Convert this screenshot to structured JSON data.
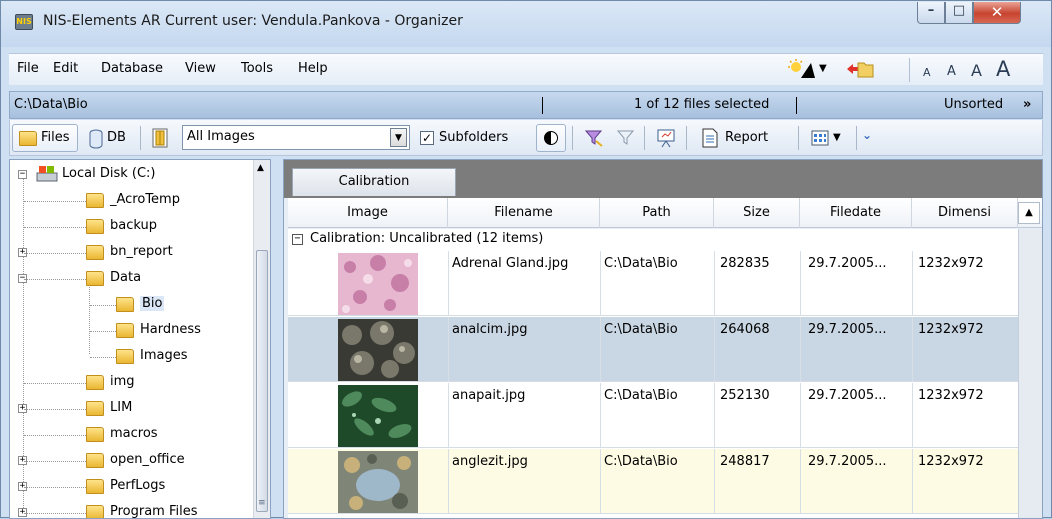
{
  "window": {
    "app_badge": "NIS",
    "title": "NIS-Elements AR  Current user: Vendula.Pankova - Organizer",
    "controls": {
      "minimize": "–",
      "maximize": "□",
      "close": "✕"
    }
  },
  "menubar": {
    "items": [
      "File",
      "Edit",
      "Database",
      "View",
      "Tools",
      "Help"
    ],
    "font_sizes": [
      "A",
      "A",
      "A",
      "A"
    ]
  },
  "pathbar": {
    "path": "C:\\Data\\Bio",
    "selection": "1 of 12 files selected",
    "sort": "Unsorted",
    "more": "»"
  },
  "toolbar": {
    "files_label": "Files",
    "db_label": "DB",
    "filter_value": "All Images",
    "subfolders_label": "Subfolders",
    "subfolders_checked": "✓",
    "report_label": "Report"
  },
  "tree": {
    "items": [
      {
        "label": "Local Disk (C:)",
        "expander": "−"
      },
      {
        "label": "_AcroTemp",
        "expander": ""
      },
      {
        "label": "backup",
        "expander": ""
      },
      {
        "label": "bn_report",
        "expander": "+"
      },
      {
        "label": "Data",
        "expander": "−"
      },
      {
        "label": "Bio",
        "expander": ""
      },
      {
        "label": "Hardness",
        "expander": ""
      },
      {
        "label": "Images",
        "expander": ""
      },
      {
        "label": "img",
        "expander": ""
      },
      {
        "label": "LIM",
        "expander": "+"
      },
      {
        "label": "macros",
        "expander": ""
      },
      {
        "label": "open_office",
        "expander": "+"
      },
      {
        "label": "PerfLogs",
        "expander": "+"
      },
      {
        "label": "Program Files",
        "expander": "+"
      }
    ]
  },
  "grid": {
    "group_button": "Calibration",
    "columns": [
      "Image",
      "Filename",
      "Path",
      "Size",
      "Filedate",
      "Dimensi"
    ],
    "group_label": "Calibration: Uncalibrated (12 items)",
    "group_toggle": "−",
    "rows": [
      {
        "filename": "Adrenal Gland.jpg",
        "path": "C:\\Data\\Bio",
        "size": "282835",
        "filedate": "29.7.2005...",
        "dimension": "1232x972",
        "bg": "#ffffff"
      },
      {
        "filename": "analcim.jpg",
        "path": "C:\\Data\\Bio",
        "size": "264068",
        "filedate": "29.7.2005...",
        "dimension": "1232x972",
        "bg": "#c9d6e3"
      },
      {
        "filename": "anapait.jpg",
        "path": "C:\\Data\\Bio",
        "size": "252130",
        "filedate": "29.7.2005...",
        "dimension": "1232x972",
        "bg": "#ffffff"
      },
      {
        "filename": "anglezit.jpg",
        "path": "C:\\Data\\Bio",
        "size": "248817",
        "filedate": "29.7.2005...",
        "dimension": "1232x972",
        "bg": "#fdfbe3"
      }
    ]
  }
}
